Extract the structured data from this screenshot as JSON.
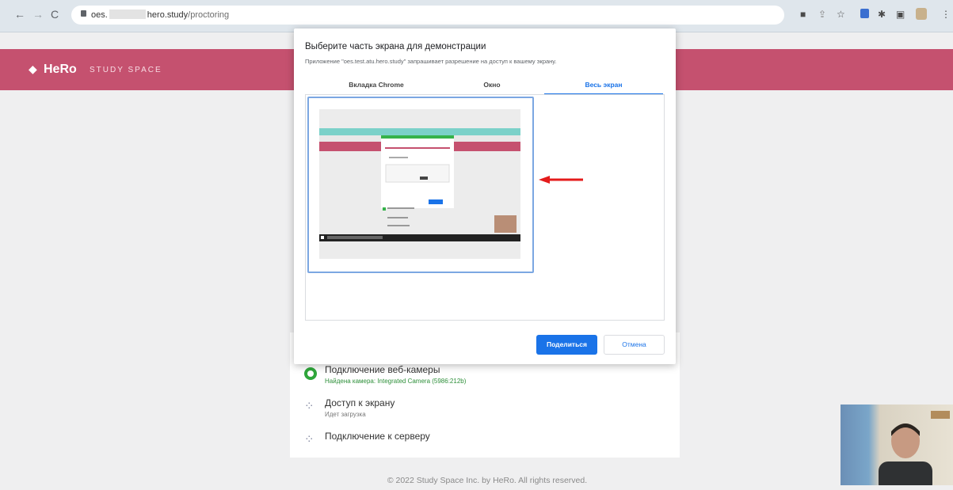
{
  "browser": {
    "url_prefix": "oes.",
    "url_host": "hero.study",
    "url_path": "/proctoring",
    "icons": [
      "back-icon",
      "forward-icon",
      "reload-icon",
      "lock-icon",
      "camera-icon",
      "share-icon",
      "star-icon",
      "extension-icon",
      "puzzle-icon",
      "sidebar-icon",
      "profile-icon",
      "menu-icon"
    ]
  },
  "site": {
    "logo_main": "HeRo",
    "logo_sub": "STUDY SPACE",
    "brand_color": "#c5516f"
  },
  "dialog": {
    "title": "Выберите часть экрана для демонстрации",
    "subtitle": "Приложение \"oes.test.atu.hero.study\" запрашивает разрешение на доступ к вашему экрану.",
    "tabs": [
      {
        "label": "Вкладка Chrome",
        "active": false
      },
      {
        "label": "Окно",
        "active": false
      },
      {
        "label": "Весь экран",
        "active": true
      }
    ],
    "share_label": "Поделиться",
    "cancel_label": "Отмена",
    "accent": "#1a73e8"
  },
  "checks": [
    {
      "title": "Подключение веб-камеры",
      "subtitle": "Найдена камера: Integrated Camera (5986:212b)",
      "status": "ok"
    },
    {
      "title": "Доступ к экрану",
      "subtitle": "Идет загрузка",
      "status": "loading"
    },
    {
      "title": "Подключение к серверу",
      "subtitle": "",
      "status": "loading"
    }
  ],
  "footer": "© 2022 Study Space Inc. by HeRo. All rights reserved."
}
